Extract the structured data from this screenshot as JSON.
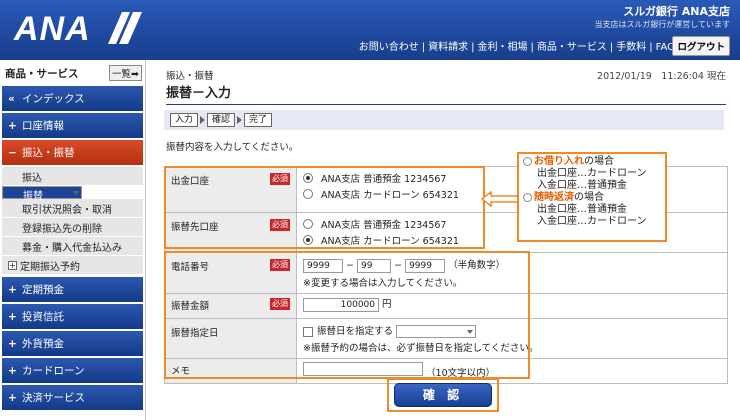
{
  "header": {
    "logo": "ANA",
    "bank_name": "スルガ銀行 ANA支店",
    "bank_sub": "当支店はスルガ銀行が運営しています",
    "nav": [
      "お問い合わせ",
      "資料請求",
      "金利・相場",
      "商品・サービス",
      "手数料",
      "FAQ"
    ],
    "logout": "ログアウト"
  },
  "sidebar": {
    "title": "商品・サービス",
    "list_button": "一覧➡",
    "top": [
      {
        "icon": "«",
        "label": "インデックス"
      },
      {
        "icon": "+",
        "label": "口座情報"
      }
    ],
    "open": {
      "icon": "−",
      "label": "振込・振替"
    },
    "subs": [
      "振込",
      "振替",
      "取引状況照会・取消",
      "登録振込先の削除",
      "募金・購入代金払込み"
    ],
    "sub_plus": "定期振込予約",
    "bottom": [
      {
        "icon": "+",
        "label": "定期預金"
      },
      {
        "icon": "+",
        "label": "投資信託"
      },
      {
        "icon": "+",
        "label": "外貨預金"
      },
      {
        "icon": "+",
        "label": "カードローン"
      },
      {
        "icon": "+",
        "label": "決済サービス"
      }
    ]
  },
  "main": {
    "breadcrumb": "振込・振替",
    "datetime": "2012/01/19　11:26:04 現在",
    "title": "振替－入力",
    "steps": [
      "入力",
      "確認",
      "完了"
    ],
    "instruction": "振替内容を入力してください。",
    "required": "必須",
    "from": {
      "label": "出金口座",
      "opts": [
        "ANA支店 普通預金 1234567",
        "ANA支店 カードローン 654321"
      ]
    },
    "to": {
      "label": "振替先口座",
      "opts": [
        "ANA支店 普通預金 1234567",
        "ANA支店 カードローン 654321"
      ]
    },
    "phone": {
      "label": "電話番号",
      "p1": "9999",
      "p2": "99",
      "p3": "9999",
      "hint": "（半角数字）",
      "note": "※変更する場合は入力してください。",
      "dash": "−"
    },
    "amount": {
      "label": "振替金額",
      "value": "100000",
      "unit": "円"
    },
    "date": {
      "label": "振替指定日",
      "check": "振替日を指定する",
      "note": "※振替予約の場合は、必ず振替日を指定してください。"
    },
    "memo": {
      "label": "メモ",
      "hint": "（10文字以内）"
    },
    "confirm": "確 認"
  },
  "callout": {
    "t1a": "お借り入れ",
    "t1b": "の場合",
    "l1": "出金口座…カードローン",
    "l2": "入金口座…普通預金",
    "t2a": "随時返済",
    "t2b": "の場合",
    "l3": "出金口座…普通預金",
    "l4": "入金口座…カードローン"
  },
  "colors": {
    "header": "#1f4aa0",
    "orange": "#f08a26",
    "required": "#c8272b"
  }
}
